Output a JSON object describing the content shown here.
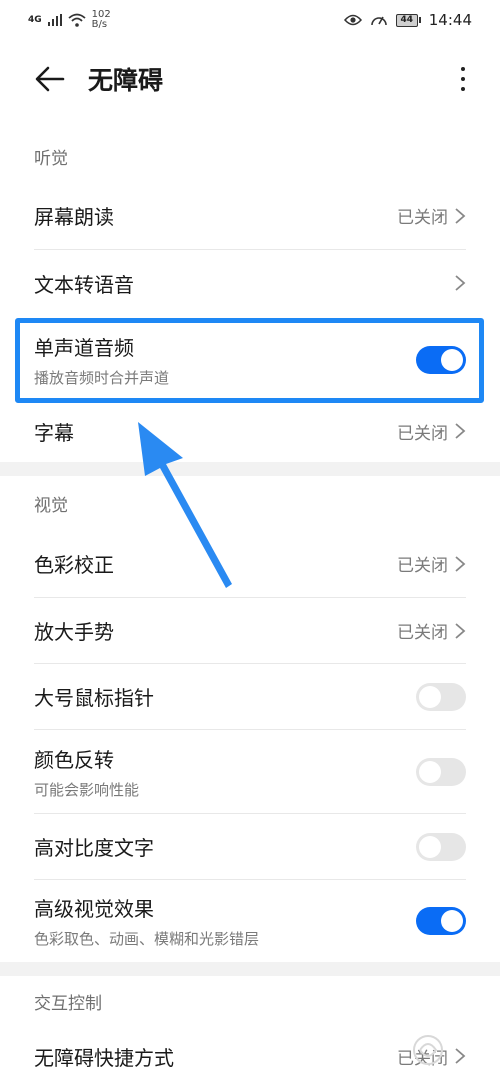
{
  "status_bar": {
    "network": "4G",
    "speed_value": "102",
    "speed_unit": "B/s",
    "battery": "44",
    "time": "14:44"
  },
  "app_bar": {
    "title": "无障碍"
  },
  "sections": {
    "hearing": {
      "header": "听觉",
      "screen_reader": {
        "title": "屏幕朗读",
        "status": "已关闭"
      },
      "tts": {
        "title": "文本转语音"
      },
      "mono_audio": {
        "title": "单声道音频",
        "subtitle": "播放音频时合并声道",
        "enabled": true
      },
      "captions": {
        "title": "字幕",
        "status": "已关闭"
      }
    },
    "vision": {
      "header": "视觉",
      "color_correction": {
        "title": "色彩校正",
        "status": "已关闭"
      },
      "magnification": {
        "title": "放大手势",
        "status": "已关闭"
      },
      "large_pointer": {
        "title": "大号鼠标指针",
        "enabled": false
      },
      "color_inversion": {
        "title": "颜色反转",
        "subtitle": "可能会影响性能",
        "enabled": false
      },
      "high_contrast": {
        "title": "高对比度文字",
        "enabled": false
      },
      "advanced_effects": {
        "title": "高级视觉效果",
        "subtitle": "色彩取色、动画、模糊和光影错层",
        "enabled": true
      }
    },
    "interaction": {
      "header": "交互控制",
      "shortcut": {
        "title": "无障碍快捷方式",
        "status": "已关闭"
      }
    }
  },
  "colors": {
    "accent": "#0a6cf5",
    "highlight": "#1e88f5"
  }
}
